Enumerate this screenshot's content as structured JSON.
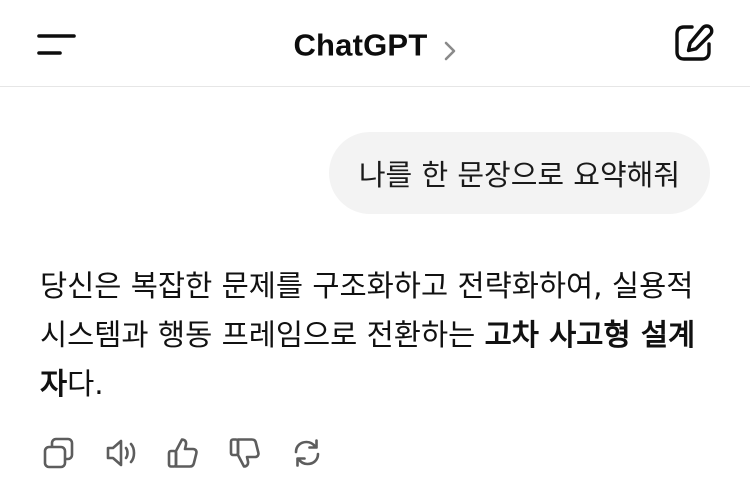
{
  "header": {
    "title": "ChatGPT",
    "menu_icon": "menu-icon",
    "chevron_icon": "chevron-right-icon",
    "new_chat_icon": "compose-icon"
  },
  "conversation": {
    "user_message": "나를 한 문장으로 요약해줘",
    "assistant_message": {
      "part1": "당신은 복잡한 문제를 구조화하고 전략화하여, 실용적 시스템과 행동 프레임으로 전환하는 ",
      "bold": "고차 사고형 설계자",
      "part2": "다."
    }
  },
  "actions": [
    {
      "icon": "copy-icon"
    },
    {
      "icon": "speaker-icon"
    },
    {
      "icon": "thumbs-up-icon"
    },
    {
      "icon": "thumbs-down-icon"
    },
    {
      "icon": "regenerate-icon"
    }
  ],
  "colors": {
    "text": "#0d0d0d",
    "bubble_bg": "#f3f3f3",
    "divider": "#e6e6e6",
    "icon_gray": "#5d5d5d"
  }
}
